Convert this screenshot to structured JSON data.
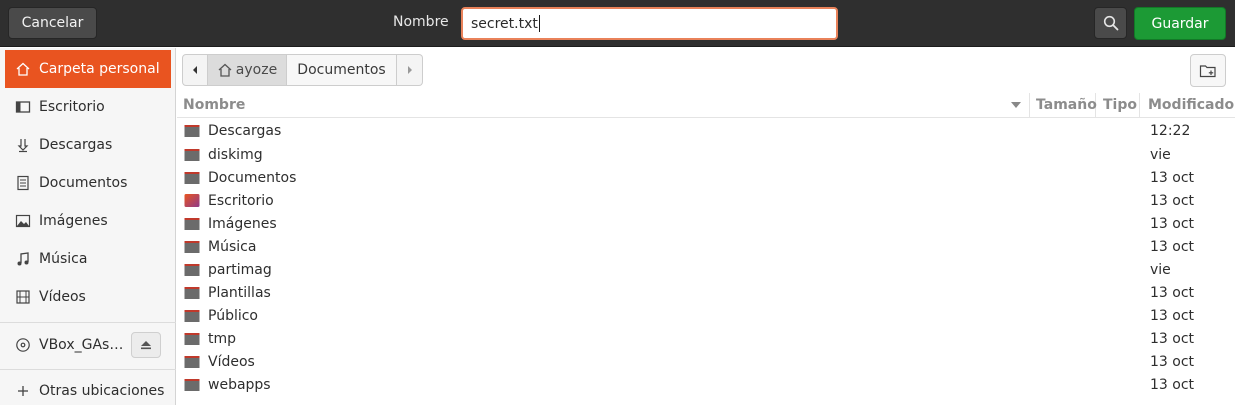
{
  "header": {
    "cancel_label": "Cancelar",
    "name_label": "Nombre",
    "filename_value": "secret.txt",
    "save_label": "Guardar",
    "search_icon": "search-icon"
  },
  "sidebar": {
    "items": [
      {
        "label": "Carpeta personal",
        "icon": "home-icon",
        "active": true
      },
      {
        "label": "Escritorio",
        "icon": "desktop-icon"
      },
      {
        "label": "Descargas",
        "icon": "download-icon"
      },
      {
        "label": "Documentos",
        "icon": "document-icon"
      },
      {
        "label": "Imágenes",
        "icon": "image-icon"
      },
      {
        "label": "Música",
        "icon": "music-icon"
      },
      {
        "label": "Vídeos",
        "icon": "video-icon"
      }
    ],
    "device": {
      "label": "VBox_GAs…",
      "icon": "disc-icon",
      "eject_icon": "eject-icon"
    },
    "other": {
      "label": "Otras ubicaciones",
      "icon": "plus-icon"
    }
  },
  "pathbar": {
    "home_label": "ayoze",
    "current_label": "Documentos"
  },
  "columns": {
    "name": "Nombre",
    "size": "Tamaño",
    "type": "Tipo",
    "modified": "Modificado"
  },
  "files": [
    {
      "name": "Descargas",
      "modified": "12:22",
      "icon": "folder-icon"
    },
    {
      "name": "diskimg",
      "modified": "vie",
      "icon": "folder-icon"
    },
    {
      "name": "Documentos",
      "modified": "13 oct",
      "icon": "folder-icon"
    },
    {
      "name": "Escritorio",
      "modified": "13 oct",
      "icon": "desktop-folder-icon"
    },
    {
      "name": "Imágenes",
      "modified": "13 oct",
      "icon": "folder-icon"
    },
    {
      "name": "Música",
      "modified": "13 oct",
      "icon": "folder-icon"
    },
    {
      "name": "partimag",
      "modified": "vie",
      "icon": "folder-icon"
    },
    {
      "name": "Plantillas",
      "modified": "13 oct",
      "icon": "folder-icon"
    },
    {
      "name": "Público",
      "modified": "13 oct",
      "icon": "folder-icon"
    },
    {
      "name": "tmp",
      "modified": "13 oct",
      "icon": "folder-icon"
    },
    {
      "name": "Vídeos",
      "modified": "13 oct",
      "icon": "folder-icon"
    },
    {
      "name": "webapps",
      "modified": "13 oct",
      "icon": "folder-icon"
    }
  ],
  "colors": {
    "accent": "#e95420",
    "save_green": "#1c9a35",
    "header_bg": "#2f2f2f"
  }
}
